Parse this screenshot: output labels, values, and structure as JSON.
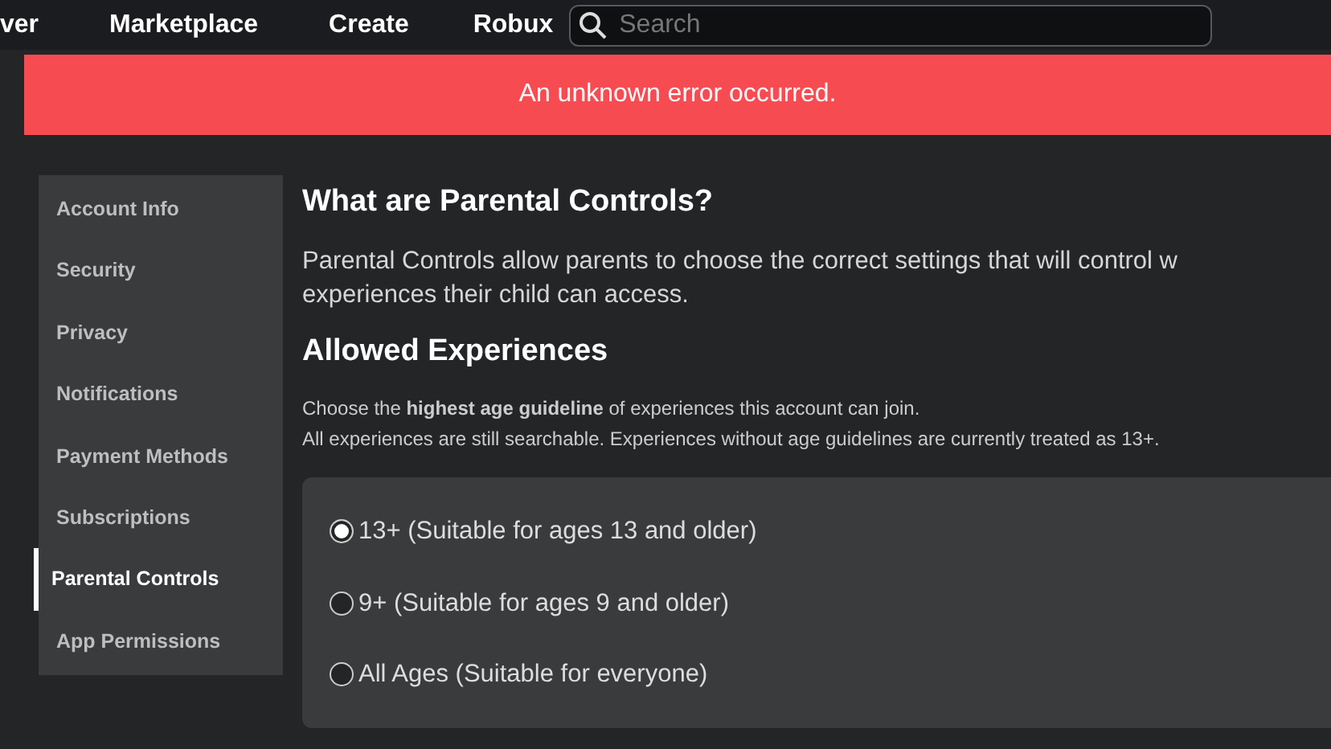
{
  "nav": {
    "links": [
      "ver",
      "Marketplace",
      "Create",
      "Robux"
    ],
    "search": {
      "placeholder": "Search"
    }
  },
  "alert": {
    "text": "An unknown error occurred."
  },
  "sidebar": {
    "items": [
      {
        "label": "Account Info",
        "selected": false
      },
      {
        "label": "Security",
        "selected": false
      },
      {
        "label": "Privacy",
        "selected": false
      },
      {
        "label": "Notifications",
        "selected": false
      },
      {
        "label": "Payment Methods",
        "selected": false
      },
      {
        "label": "Subscriptions",
        "selected": false
      },
      {
        "label": "Parental Controls",
        "selected": true
      },
      {
        "label": "App Permissions",
        "selected": false
      }
    ]
  },
  "content": {
    "title": "What are Parental Controls?",
    "description_lines": [
      "Parental Controls allow parents to choose the correct settings that will control w",
      "experiences their child can access."
    ],
    "section_title": "Allowed Experiences",
    "hint": "Choose the **highest age guideline** of experiences this account can join.",
    "note": "All experiences are still searchable. Experiences without age guidelines are currently treated as 13+.",
    "options": [
      {
        "label": "13+ (Suitable for ages 13 and older)",
        "selected": true
      },
      {
        "label": "9+ (Suitable for ages 9 and older)",
        "selected": false
      },
      {
        "label": "All Ages (Suitable for everyone)",
        "selected": false
      }
    ]
  }
}
